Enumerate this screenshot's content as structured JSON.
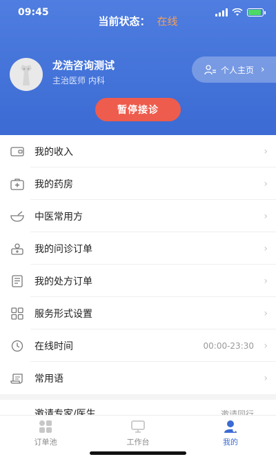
{
  "status_bar": {
    "time": "09:45"
  },
  "header": {
    "status_label": "当前状态：",
    "status_value": "在线",
    "doctor_name": "龙浩咨询测试",
    "doctor_role": "主治医师 内科",
    "homepage_label": "个人主页",
    "pause_label": "暂停接诊"
  },
  "menu": {
    "items": [
      {
        "label": "我的收入",
        "icon": "wallet-icon"
      },
      {
        "label": "我的药房",
        "icon": "medicine-box-icon"
      },
      {
        "label": "中医常用方",
        "icon": "mortar-icon"
      },
      {
        "label": "我的问诊订单",
        "icon": "consultation-icon"
      },
      {
        "label": "我的处方订单",
        "icon": "prescription-icon"
      },
      {
        "label": "服务形式设置",
        "icon": "grid-icon"
      },
      {
        "label": "在线时间",
        "icon": "clock-icon",
        "extra": "00:00-23:30"
      },
      {
        "label": "常用语",
        "icon": "scroll-icon"
      }
    ],
    "partial": {
      "label": "邀请专家/医生",
      "extra": "邀请同行"
    }
  },
  "tabbar": {
    "tabs": [
      {
        "label": "订单池",
        "icon": "order-pool-icon"
      },
      {
        "label": "工作台",
        "icon": "workbench-icon"
      },
      {
        "label": "我的",
        "icon": "profile-icon",
        "active": true
      }
    ]
  },
  "colors": {
    "primary": "#3b6bd3",
    "online": "#f5a05a",
    "pause": "#ee5c4d"
  }
}
